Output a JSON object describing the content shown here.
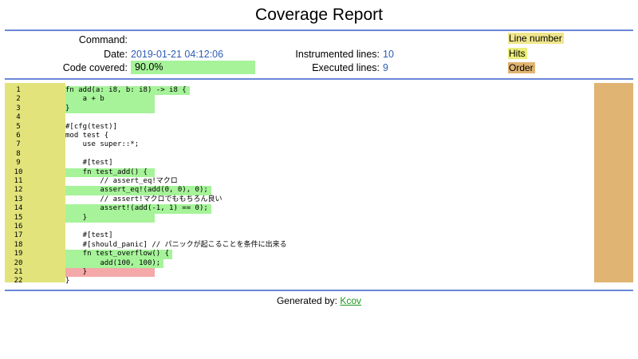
{
  "title": "Coverage Report",
  "header": {
    "command_label": "Command:",
    "command_value": "",
    "date_label": "Date:",
    "date_value": "2019-01-21 04:12:06",
    "covered_label": "Code covered:",
    "covered_value": "90.0%",
    "covered_fraction": 0.9,
    "instrumented_label": "Instrumented lines:",
    "instrumented_value": "10",
    "executed_label": "Executed lines:",
    "executed_value": "9"
  },
  "legend": {
    "line_number": "Line number",
    "hits": "Hits",
    "order": "Order"
  },
  "colors": {
    "hit": "#a6f39a",
    "miss": "#f5a8a8",
    "line_number_bg": "#e2e47b",
    "order_bg": "#e0b472",
    "rule": "#6a86d6",
    "link": "#1a9b1a"
  },
  "code": [
    {
      "num": "1",
      "text": "fn add(a: i8, b: i8) -> i8 {",
      "status": "hit"
    },
    {
      "num": "2",
      "text": "    a + b",
      "status": "hit"
    },
    {
      "num": "3",
      "text": "}",
      "status": "hit"
    },
    {
      "num": "4",
      "text": "",
      "status": "none"
    },
    {
      "num": "5",
      "text": "#[cfg(test)]",
      "status": "none"
    },
    {
      "num": "6",
      "text": "mod test {",
      "status": "none"
    },
    {
      "num": "7",
      "text": "    use super::*;",
      "status": "none"
    },
    {
      "num": "8",
      "text": "",
      "status": "none"
    },
    {
      "num": "9",
      "text": "    #[test]",
      "status": "none"
    },
    {
      "num": "10",
      "text": "    fn test_add() {",
      "status": "hit"
    },
    {
      "num": "11",
      "text": "        // assert_eq!マクロ",
      "status": "none"
    },
    {
      "num": "12",
      "text": "        assert_eq!(add(0, 0), 0);",
      "status": "hit"
    },
    {
      "num": "13",
      "text": "        // assert!マクロでももちろん良い",
      "status": "none"
    },
    {
      "num": "14",
      "text": "        assert!(add(-1, 1) == 0);",
      "status": "hit"
    },
    {
      "num": "15",
      "text": "    }",
      "status": "hit"
    },
    {
      "num": "16",
      "text": "",
      "status": "none"
    },
    {
      "num": "17",
      "text": "    #[test]",
      "status": "none"
    },
    {
      "num": "18",
      "text": "    #[should_panic] // パニックが起こることを条件に出来る",
      "status": "none"
    },
    {
      "num": "19",
      "text": "    fn test_overflow() {",
      "status": "hit"
    },
    {
      "num": "20",
      "text": "        add(100, 100);",
      "status": "hit"
    },
    {
      "num": "21",
      "text": "    }",
      "status": "miss"
    },
    {
      "num": "22",
      "text": "}",
      "status": "none"
    }
  ],
  "footer": {
    "generated_label": "Generated by:",
    "kcov_link": "Kcov"
  }
}
